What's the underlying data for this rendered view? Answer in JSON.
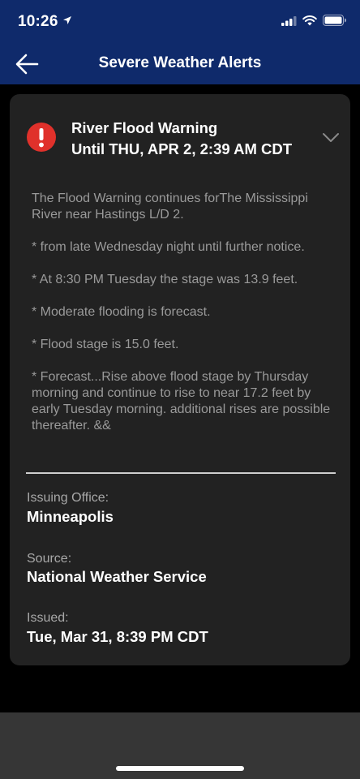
{
  "status": {
    "time": "10:26"
  },
  "nav": {
    "title": "Severe Weather Alerts"
  },
  "alert": {
    "title": "River Flood Warning",
    "until": "Until THU, APR 2, 2:39 AM CDT",
    "accent": "#e0312b",
    "paragraphs": [
      "The Flood Warning continues forThe Mississippi River near Hastings L/D 2.",
      "* from late Wednesday night until further notice.",
      "* At  8:30 PM Tuesday the stage was 13.9 feet.",
      "* Moderate flooding is forecast.",
      "* Flood stage is 15.0 feet.",
      "* Forecast...Rise above flood stage by Thursday morning and continue to rise to near 17.2 feet by early Tuesday morning. additional rises are possible thereafter. &&"
    ]
  },
  "details": {
    "office_label": "Issuing Office:",
    "office_value": "Minneapolis",
    "source_label": "Source:",
    "source_value": "National Weather Service",
    "issued_label": "Issued:",
    "issued_value": "Tue, Mar 31, 8:39 PM CDT"
  },
  "colors": {
    "header": "#0f2a6b",
    "card": "#222222"
  }
}
